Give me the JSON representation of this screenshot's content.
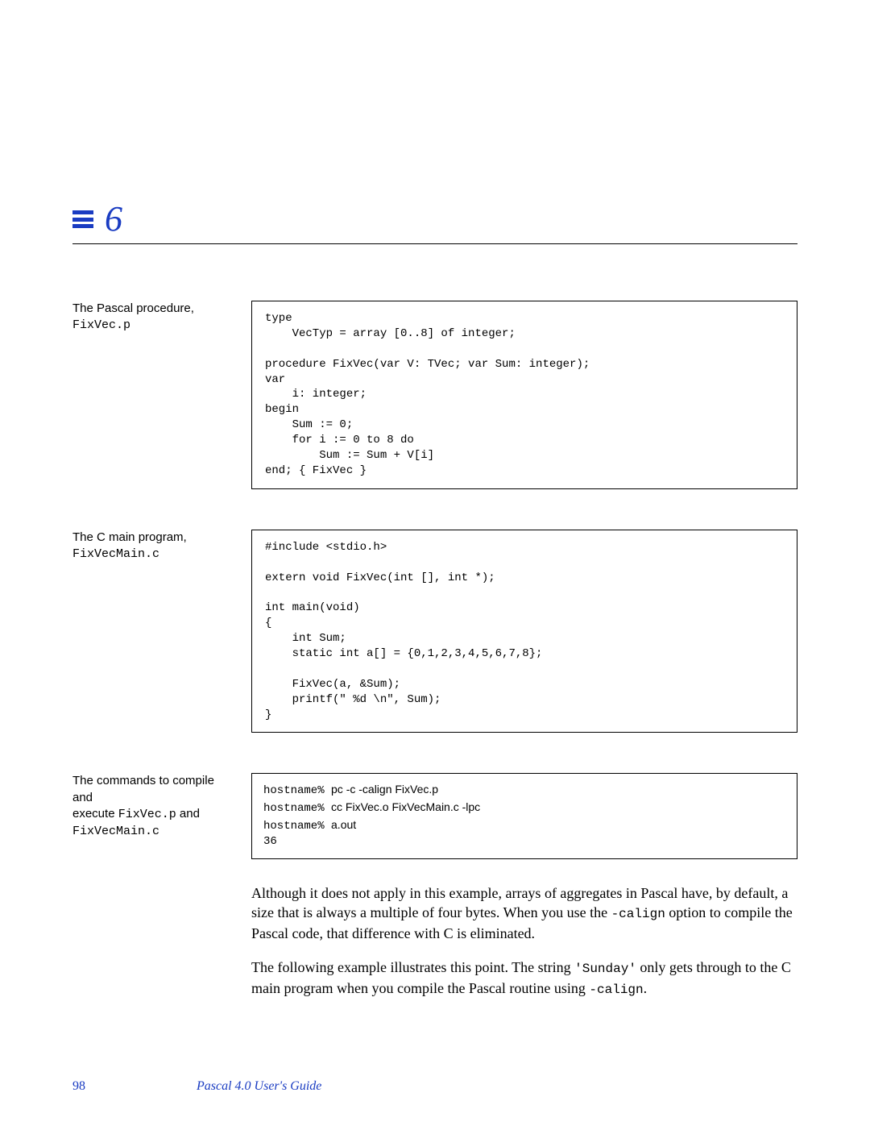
{
  "header": {
    "chapter": "6"
  },
  "sections": {
    "pascal": {
      "caption_text": "The Pascal procedure,",
      "caption_file": "FixVec.p",
      "code": "type\n    VecTyp = array [0..8] of integer;\n\nprocedure FixVec(var V: TVec; var Sum: integer);\nvar\n    i: integer;\nbegin\n    Sum := 0;\n    for i := 0 to 8 do\n        Sum := Sum + V[i]\nend; { FixVec }"
    },
    "cmain": {
      "caption_text": "The C main program,",
      "caption_file": "FixVecMain.c",
      "code": "#include <stdio.h>\n\nextern void FixVec(int [], int *);\n\nint main(void)\n{\n    int Sum;\n    static int a[] = {0,1,2,3,4,5,6,7,8};\n\n    FixVec(a, &Sum);\n    printf(\" %d \\n\", Sum);\n}"
    },
    "commands": {
      "caption_line1": "The commands to compile and",
      "caption_line2a": "execute ",
      "caption_file1": "FixVec.p",
      "caption_line2b": " and",
      "caption_file2": "FixVecMain.c",
      "prompt1": "hostname% ",
      "cmd1": "pc -c -calign FixVec.p",
      "prompt2": "hostname% ",
      "cmd2": "cc FixVec.o FixVecMain.c -lpc",
      "prompt3": "hostname% ",
      "cmd3": "a.out",
      "output": " 36"
    }
  },
  "body": {
    "p1a": "Although it does not apply in this example, arrays of aggregates in Pascal have, by default, a size that is always a multiple of four bytes.  When you use the ",
    "p1mono": "-calign",
    "p1b": " option to compile the Pascal code, that difference with C is eliminated.",
    "p2a": "The following example illustrates this point.  The string ",
    "p2mono1": "'Sunday'",
    "p2b": " only gets through to the C main program when you compile the Pascal routine using ",
    "p2mono2": "-calign",
    "p2c": "."
  },
  "footer": {
    "page": "98",
    "title": "Pascal 4.0 User's Guide"
  }
}
